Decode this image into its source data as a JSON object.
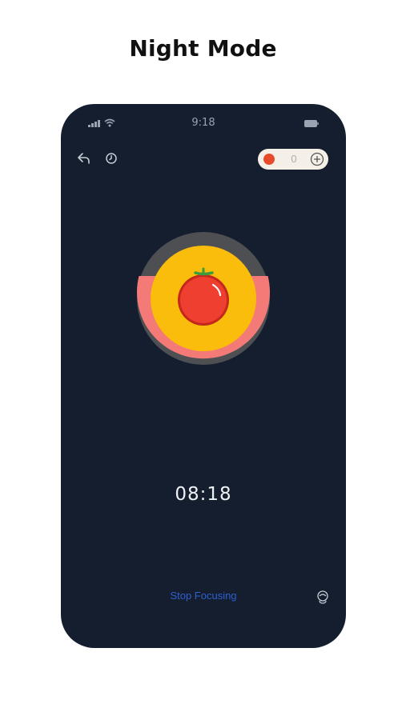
{
  "headline": "Night Mode",
  "status_bar": {
    "time": "9:18",
    "icons": [
      "signal-icon",
      "wifi-icon",
      "battery-icon"
    ]
  },
  "toolbar": {
    "left_icons": [
      "back-arrow-icon",
      "clock-icon"
    ],
    "counter": {
      "value": "0",
      "icons": [
        "tomato-dot-icon",
        "plus-circle-icon"
      ]
    }
  },
  "dial": {
    "center_icon": "tomato-icon",
    "progress_color": "#f47a78",
    "track_color": "#4d4f52",
    "face_color": "#fbbd0b",
    "tomato_color": "#ee3f30"
  },
  "timer": {
    "display": "08:18"
  },
  "footer": {
    "stop_label": "Stop Focusing",
    "sound_icon": "sound-icon"
  },
  "colors": {
    "phone_background": "#141e2e",
    "accent_link": "#2f5fd0"
  }
}
